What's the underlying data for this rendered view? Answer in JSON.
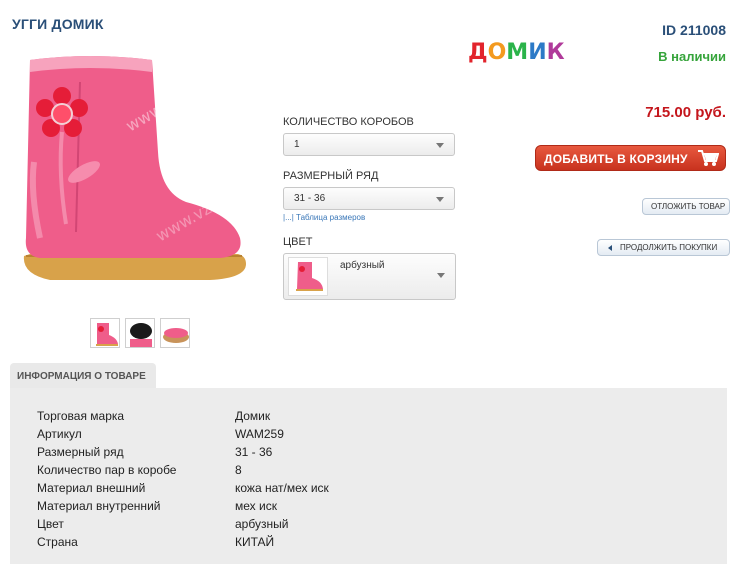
{
  "product": {
    "title": "УГГИ ДОМИК",
    "id_text": "ID 211008",
    "availability": "В наличии",
    "price": "715.00 руб.",
    "brand_logo_letters": [
      "Д",
      "О",
      "М",
      "И",
      "К"
    ],
    "brand_logo_colors": [
      "#e2242c",
      "#f39a1f",
      "#2bb34a",
      "#2c7ac7",
      "#b03a9a"
    ]
  },
  "options": {
    "boxes_label": "КОЛИЧЕСТВО КОРОБОВ",
    "boxes_value": "1",
    "size_label": "РАЗМЕРНЫЙ РЯД",
    "size_value": "31 - 36",
    "size_table_link": "|...| Таблица размеров",
    "color_label": "ЦВЕТ",
    "color_value": "арбузный"
  },
  "actions": {
    "add_to_cart": "ДОБАВИТЬ В КОРЗИНУ",
    "postpone": "ОТЛОЖИТЬ ТОВАР",
    "continue_shopping": "ПРОДОЛЖИТЬ ПОКУПКИ"
  },
  "info": {
    "tab_label": "ИНФОРМАЦИЯ О ТОВАРЕ",
    "rows": [
      {
        "key": "Торговая марка",
        "value": "Домик"
      },
      {
        "key": "Артикул",
        "value": "WAM259"
      },
      {
        "key": "Размерный ряд",
        "value": "31 - 36"
      },
      {
        "key": "Количество пар в коробе",
        "value": "8"
      },
      {
        "key": "Материал внешний",
        "value": "кожа нат/мех иск"
      },
      {
        "key": "Материал внутренний",
        "value": "мех иск"
      },
      {
        "key": "Цвет",
        "value": "арбузный"
      },
      {
        "key": "Страна",
        "value": "КИТАЙ"
      }
    ]
  },
  "colors": {
    "boot_pink": "#f0608a",
    "title_blue": "#2a4f78",
    "price_red": "#c4161c",
    "stock_green": "#36a43b",
    "cart_red": "#d6402a"
  },
  "icons": {
    "cart": "shopping-cart-icon",
    "continue": "arrow-left-icon",
    "dropdown": "chevron-down-icon"
  }
}
